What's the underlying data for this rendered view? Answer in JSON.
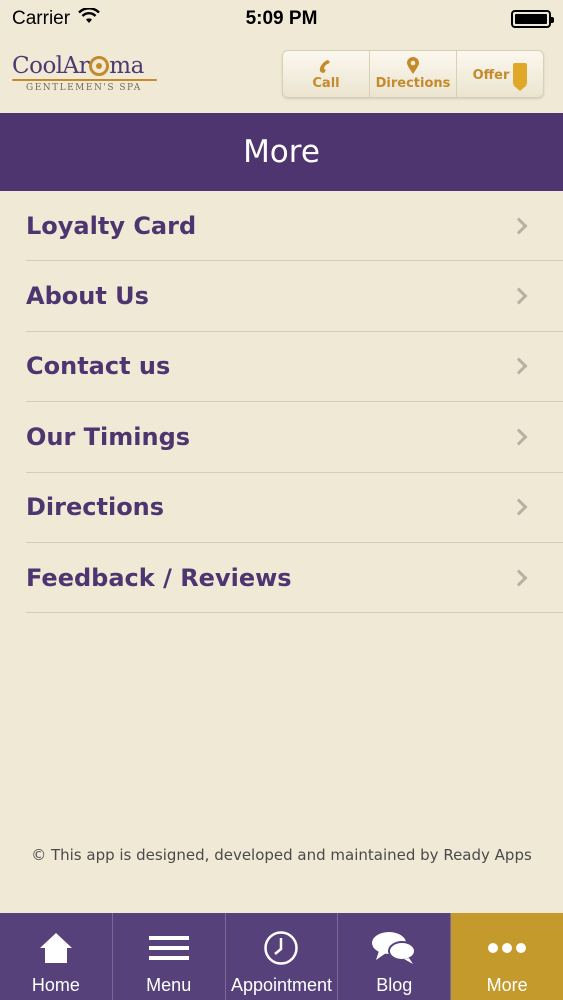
{
  "status_bar": {
    "carrier": "Carrier",
    "time": "5:09 PM"
  },
  "header": {
    "logo_text": "CoolArama",
    "logo_sub": "GENTLEMEN'S SPA",
    "actions": [
      {
        "label": "Call",
        "icon": "phone-icon"
      },
      {
        "label": "Directions",
        "icon": "map-pin-icon"
      },
      {
        "label": "Offer",
        "icon": "tag-icon"
      }
    ]
  },
  "page": {
    "title": "More"
  },
  "menu": {
    "items": [
      {
        "label": "Loyalty Card"
      },
      {
        "label": "About Us"
      },
      {
        "label": "Contact us"
      },
      {
        "label": "Our Timings"
      },
      {
        "label": "Directions"
      },
      {
        "label": "Feedback / Reviews"
      }
    ]
  },
  "footer": {
    "note": "© This app is designed, developed and maintained by Ready Apps"
  },
  "tabs": [
    {
      "label": "Home",
      "icon": "home-icon",
      "active": false
    },
    {
      "label": "Menu",
      "icon": "menu-icon",
      "active": false
    },
    {
      "label": "Appointment",
      "icon": "clock-icon",
      "active": false
    },
    {
      "label": "Blog",
      "icon": "chat-bubbles-icon",
      "active": false
    },
    {
      "label": "More",
      "icon": "more-dots-icon",
      "active": true
    }
  ],
  "colors": {
    "primary_purple": "#4e3570",
    "accent_gold": "#c59a2c",
    "background_cream": "#efe9d6"
  }
}
